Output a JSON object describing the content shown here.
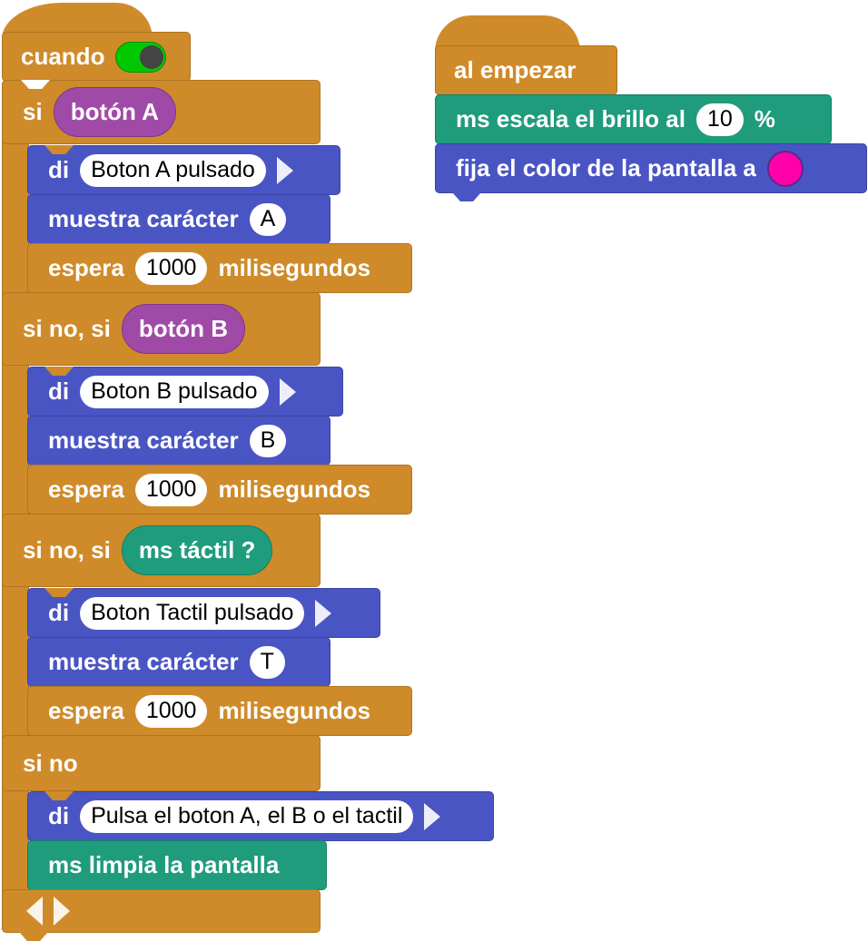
{
  "hat_forever": {
    "label": "cuando"
  },
  "if_block": {
    "branch_if": "si",
    "branch_elseif": "si no, si",
    "branch_else": "si no",
    "cond_a": "botón A",
    "cond_b": "botón B",
    "cond_touch": "ms táctil ?",
    "say_kw": "di",
    "show_kw": "muestra carácter",
    "wait_kw": "espera",
    "wait_unit": "milisegundos",
    "branches": [
      {
        "say": "Boton A pulsado",
        "char": "A",
        "wait": "1000"
      },
      {
        "say": "Boton B pulsado",
        "char": "B",
        "wait": "1000"
      },
      {
        "say": "Boton Tactil pulsado",
        "char": "T",
        "wait": "1000"
      }
    ],
    "else_say": "Pulsa el boton A, el B o el tactil",
    "clear_label": "ms limpia la pantalla"
  },
  "hat_start": {
    "label": "al empezar",
    "brightness_pre": "ms escala el brillo al",
    "brightness_value": "10",
    "brightness_unit": "%",
    "color_label": "fija el color de la pantalla a",
    "color_value": "#ff00aa"
  },
  "colors": {
    "control": "#cf8b2a",
    "looks": "#4a55c4",
    "ms": "#1f9c7c",
    "sensing": "#a04aa8",
    "toggle_on": "#00c800"
  }
}
